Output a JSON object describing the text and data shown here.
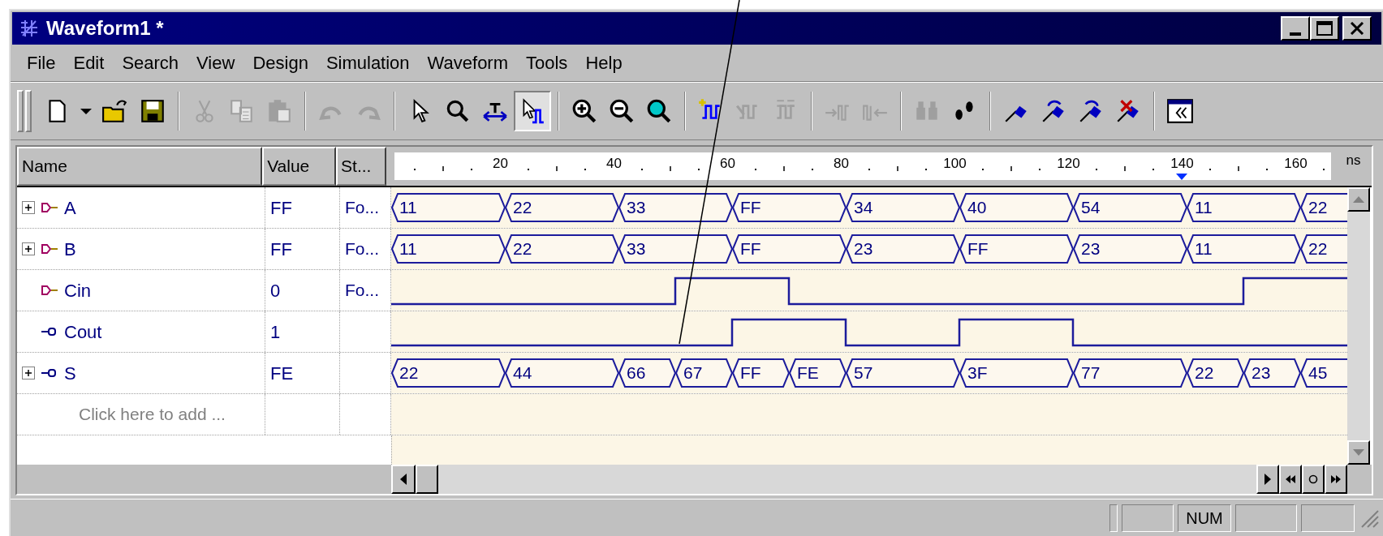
{
  "window": {
    "title": "Waveform1 *"
  },
  "menu": [
    {
      "label": "File"
    },
    {
      "label": "Edit"
    },
    {
      "label": "Search"
    },
    {
      "label": "View"
    },
    {
      "label": "Design"
    },
    {
      "label": "Simulation"
    },
    {
      "label": "Waveform"
    },
    {
      "label": "Tools"
    },
    {
      "label": "Help"
    }
  ],
  "toolbar": {
    "groups": [
      [
        {
          "kind": "new",
          "disabled": false,
          "pressed": false
        },
        {
          "kind": "dropdown",
          "disabled": false,
          "pressed": false
        },
        {
          "kind": "open",
          "disabled": false,
          "pressed": false
        },
        {
          "kind": "save",
          "disabled": false,
          "pressed": false
        }
      ],
      [
        {
          "kind": "cut",
          "disabled": true,
          "pressed": false
        },
        {
          "kind": "copy",
          "disabled": true,
          "pressed": false
        },
        {
          "kind": "paste",
          "disabled": true,
          "pressed": false
        }
      ],
      [
        {
          "kind": "undo",
          "disabled": true,
          "pressed": false
        },
        {
          "kind": "redo",
          "disabled": true,
          "pressed": false
        }
      ],
      [
        {
          "kind": "pointer",
          "disabled": false,
          "pressed": false
        },
        {
          "kind": "zoom",
          "disabled": false,
          "pressed": false
        },
        {
          "kind": "measure",
          "disabled": false,
          "pressed": false
        },
        {
          "kind": "waveselect",
          "disabled": false,
          "pressed": true
        }
      ],
      [
        {
          "kind": "zoomin",
          "disabled": false,
          "pressed": false
        },
        {
          "kind": "zoomout",
          "disabled": false,
          "pressed": false
        },
        {
          "kind": "zoomfit",
          "disabled": false,
          "pressed": false
        }
      ],
      [
        {
          "kind": "addsignal",
          "disabled": false,
          "pressed": false
        },
        {
          "kind": "editsignal",
          "disabled": true,
          "pressed": false
        },
        {
          "kind": "bussignal",
          "disabled": true,
          "pressed": false
        }
      ],
      [
        {
          "kind": "shiftright",
          "disabled": true,
          "pressed": false
        },
        {
          "kind": "shiftleft",
          "disabled": true,
          "pressed": false
        }
      ],
      [
        {
          "kind": "find",
          "disabled": true,
          "pressed": false
        },
        {
          "kind": "steps",
          "disabled": false,
          "pressed": false
        }
      ],
      [
        {
          "kind": "flag",
          "disabled": false,
          "pressed": false
        },
        {
          "kind": "flagnext",
          "disabled": false,
          "pressed": false
        },
        {
          "kind": "flagprev",
          "disabled": false,
          "pressed": false
        },
        {
          "kind": "flagdelete",
          "disabled": false,
          "pressed": false
        }
      ],
      [
        {
          "kind": "collapse",
          "disabled": false,
          "pressed": false
        }
      ]
    ]
  },
  "table": {
    "columns": [
      "Name",
      "Value",
      "St..."
    ],
    "timeline": {
      "labels": [
        {
          "text": "20",
          "cursor": false
        },
        {
          "text": "40",
          "cursor": false
        },
        {
          "text": "60",
          "cursor": false
        },
        {
          "text": "80",
          "cursor": false
        },
        {
          "text": "100",
          "cursor": false
        },
        {
          "text": "120",
          "cursor": false
        },
        {
          "text": "140",
          "cursor": true
        },
        {
          "text": "160",
          "cursor": false
        }
      ],
      "unit": "ns"
    },
    "rows": [
      {
        "name": "A",
        "kind": "input",
        "expanded": false,
        "value": "FF",
        "status": "Fo...",
        "wave": {
          "kind": "bus",
          "segments": [
            {
              "value": "11",
              "kind": "wide"
            },
            {
              "value": "22",
              "kind": "wide"
            },
            {
              "value": "33",
              "kind": "wide"
            },
            {
              "value": "FF",
              "kind": "wide"
            },
            {
              "value": "34",
              "kind": "wide"
            },
            {
              "value": "40",
              "kind": "wide"
            },
            {
              "value": "54",
              "kind": "wide"
            },
            {
              "value": "11",
              "kind": "wide"
            },
            {
              "value": "22",
              "kind": "wide"
            }
          ]
        }
      },
      {
        "name": "B",
        "kind": "input",
        "expanded": false,
        "value": "FF",
        "status": "Fo...",
        "wave": {
          "kind": "bus",
          "segments": [
            {
              "value": "11",
              "kind": "wide"
            },
            {
              "value": "22",
              "kind": "wide"
            },
            {
              "value": "33",
              "kind": "wide"
            },
            {
              "value": "FF",
              "kind": "wide"
            },
            {
              "value": "23",
              "kind": "wide"
            },
            {
              "value": "FF",
              "kind": "wide"
            },
            {
              "value": "23",
              "kind": "wide"
            },
            {
              "value": "11",
              "kind": "wide"
            },
            {
              "value": "22",
              "kind": "wide"
            }
          ]
        }
      },
      {
        "name": "Cin",
        "kind": "input",
        "value": "0",
        "status": "Fo...",
        "wave": {
          "kind": "bit"
        }
      },
      {
        "name": "Cout",
        "kind": "output",
        "value": "1",
        "wave": {
          "kind": "bit"
        }
      },
      {
        "name": "S",
        "kind": "output",
        "expanded": false,
        "value": "FE",
        "wave": {
          "kind": "bus",
          "segments": [
            {
              "value": "22",
              "kind": "wide"
            },
            {
              "value": "44",
              "kind": "wide"
            },
            {
              "value": "66",
              "kind": "narrow"
            },
            {
              "value": "67",
              "kind": "narrow"
            },
            {
              "value": "FF",
              "kind": "narrow"
            },
            {
              "value": "FE",
              "kind": "narrow"
            },
            {
              "value": "57",
              "kind": "wide"
            },
            {
              "value": "3F",
              "kind": "wide"
            },
            {
              "value": "77",
              "kind": "wide"
            },
            {
              "value": "22",
              "kind": "narrow"
            },
            {
              "value": "23",
              "kind": "narrow"
            },
            {
              "value": "45",
              "kind": "wide"
            }
          ]
        }
      }
    ],
    "add_row": {
      "placeholder": "Click here to add ..."
    }
  },
  "status_bar": {
    "indicators": [
      "NUM"
    ]
  }
}
